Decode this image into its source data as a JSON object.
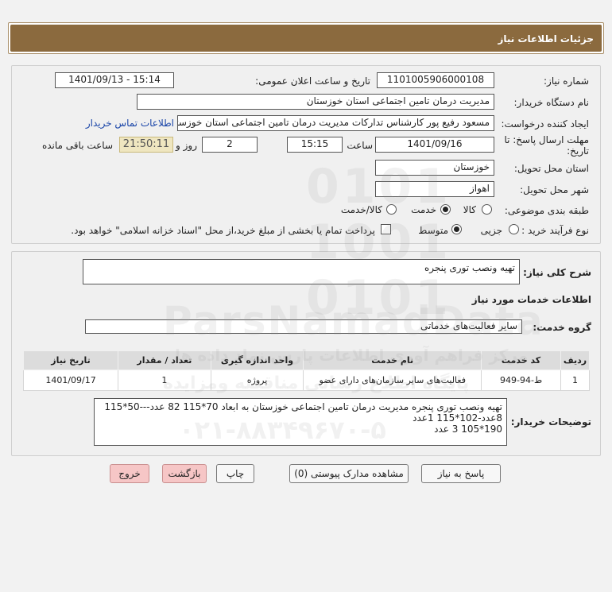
{
  "page": {
    "title": "جزئیات اطلاعات نیاز"
  },
  "form": {
    "need_number_label": "شماره نیاز:",
    "need_number": "1101005906000108",
    "announce_label": "تاریخ و ساعت اعلان عمومی:",
    "announce_value": "1401/09/13 - 15:14",
    "buyer_org_label": "نام دستگاه خریدار:",
    "buyer_org": "مدیریت درمان تامین اجتماعی استان خوزستان",
    "requester_label": "ایجاد کننده درخواست:",
    "requester": "مسعود رفیع پور کارشناس تدارکات مدیریت درمان تامین اجتماعی استان خوزستان",
    "contact_link": "اطلاعات تماس خریدار",
    "deadline_label_1": "مهلت ارسال پاسخ: تا",
    "deadline_label_2": "تاریخ:",
    "deadline_date": "1401/09/16",
    "time_label": "ساعت",
    "deadline_time": "15:15",
    "days_value": "2",
    "days_label": "روز و",
    "remaining_time": "21:50:11",
    "remaining_label": "ساعت باقی مانده",
    "province_label": "استان محل تحویل:",
    "province": "خوزستان",
    "city_label": "شهر محل تحویل:",
    "city": "اهواز",
    "category_label": "طبقه بندی موضوعی:",
    "category_options": [
      "کالا",
      "خدمت",
      "کالا/خدمت"
    ],
    "category_selected": "خدمت",
    "purchase_type_label": "نوع فرآیند خرید :",
    "purchase_type_options": [
      "جزیی",
      "متوسط"
    ],
    "purchase_type_selected": "متوسط",
    "payment_note": "پرداخت تمام یا بخشی از مبلغ خرید،از محل \"اسناد خزانه اسلامی\" خواهد بود."
  },
  "details": {
    "summary_label": "شرح کلی نیاز:",
    "summary": "تهیه ونصب توری پنجره",
    "services_title": "اطلاعات خدمات مورد نیاز",
    "service_group_label": "گروه خدمت:",
    "service_group": "سایر فعالیت‌های خدماتی",
    "table": {
      "headers": [
        "ردیف",
        "کد خدمت",
        "نام خدمت",
        "واحد اندازه گیری",
        "تعداد / مقدار",
        "تاریخ نیاز"
      ],
      "rows": [
        [
          "1",
          "ط-94-949",
          "فعالیت‌های سایر سازمان‌های دارای عضو",
          "پروژه",
          "1",
          "1401/09/17"
        ]
      ]
    },
    "buyer_notes_label": "توضیحات خریدار:",
    "buyer_notes": [
      "تهیه ونصب توری پنجره مدیریت درمان تامین اجتماعی خوزستان  به ابعاد 70*115  82 عدد---50*115",
      "8عدد-102*115 1عدد",
      "190*105   3 عدد"
    ]
  },
  "buttons": {
    "reply": "پاسخ به نیاز",
    "attachments": "مشاهده مدارک پیوستی (0)",
    "print": "چاپ",
    "back": "بازگشت",
    "exit": "خروج"
  },
  "watermark": {
    "brand": "ParsNamadData",
    "line1": "مرکز فراهم آوری اطلاعات پارس نماد داده ها",
    "line2": "پایگاه اطلاع رسانی مناقصه ومزایده",
    "phone": "۰۲۱-۸۸۳۴۹۶۷۰-۵"
  }
}
